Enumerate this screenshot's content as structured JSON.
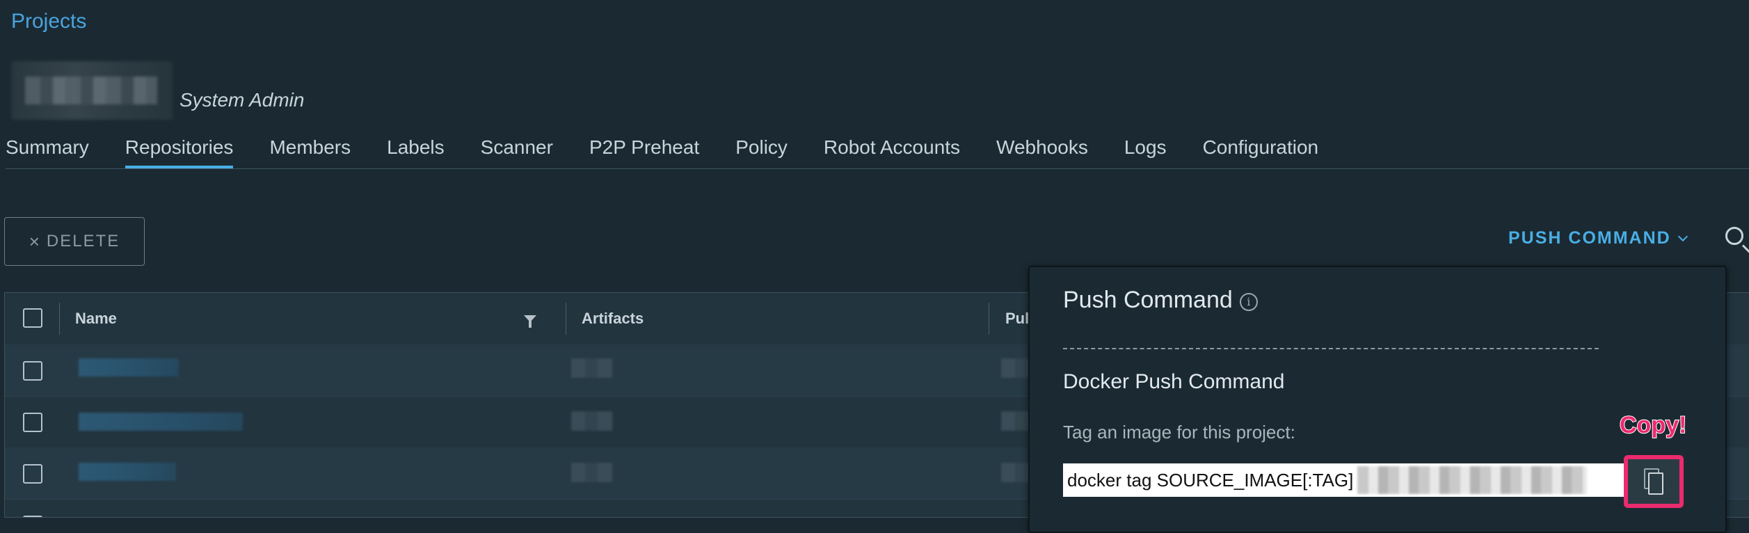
{
  "header": {
    "breadcrumb": "Projects",
    "role": "System Admin"
  },
  "tabs": [
    {
      "label": "Summary",
      "active": false
    },
    {
      "label": "Repositories",
      "active": true
    },
    {
      "label": "Members",
      "active": false
    },
    {
      "label": "Labels",
      "active": false
    },
    {
      "label": "Scanner",
      "active": false
    },
    {
      "label": "P2P Preheat",
      "active": false
    },
    {
      "label": "Policy",
      "active": false
    },
    {
      "label": "Robot Accounts",
      "active": false
    },
    {
      "label": "Webhooks",
      "active": false
    },
    {
      "label": "Logs",
      "active": false
    },
    {
      "label": "Configuration",
      "active": false
    }
  ],
  "toolbar": {
    "delete_icon": "×",
    "delete_label": "DELETE",
    "push_command_label": "PUSH COMMAND"
  },
  "table": {
    "columns": [
      "Name",
      "Artifacts",
      "Pul"
    ]
  },
  "popover": {
    "title": "Push Command",
    "info_glyph": "i",
    "divider": "- - - - - - - - - - - - - - - - - - - - - - - - - - - - - - - - - - - - - - - - -",
    "subtitle": "Docker Push Command",
    "tag_label": "Tag an image for this project:",
    "tag_command": "docker tag SOURCE_IMAGE[:TAG]",
    "copy_annotation": "Copy!"
  },
  "colors": {
    "accent": "#49aee6",
    "annotation": "#ec2a6e",
    "background": "#1b2a32"
  }
}
